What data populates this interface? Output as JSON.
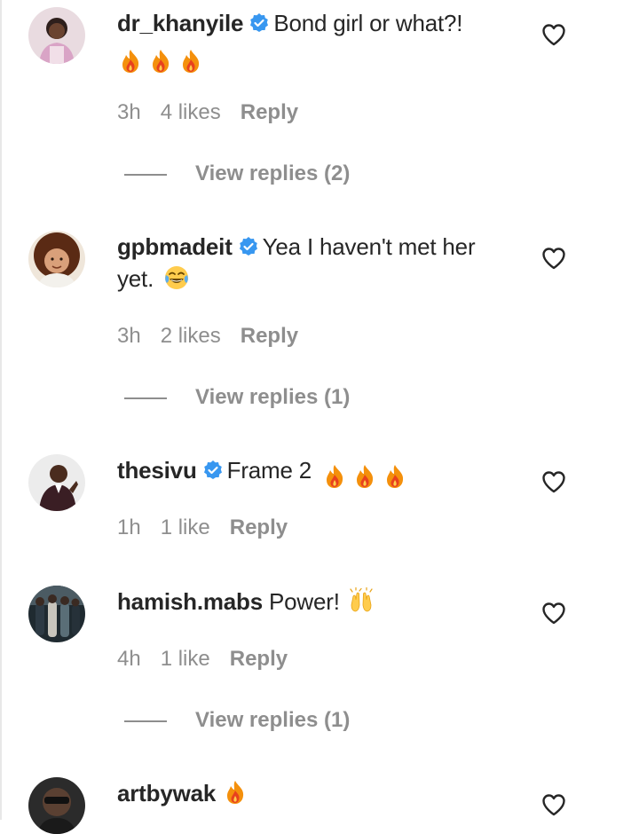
{
  "comments": [
    {
      "username": "dr_khanyile",
      "verified": true,
      "text": "Bond girl or what?!",
      "emojis": [
        "fire-emoji",
        "fire-emoji",
        "fire-emoji"
      ],
      "time": "3h",
      "likes": "4 likes",
      "reply_label": "Reply",
      "view_replies": "View replies (2)"
    },
    {
      "username": "gpbmadeit",
      "verified": true,
      "text_line1": "Yea I haven't met her",
      "text_line2": "yet.",
      "emojis": [
        "tears-of-joy-emoji"
      ],
      "time": "3h",
      "likes": "2 likes",
      "reply_label": "Reply",
      "view_replies": "View replies (1)"
    },
    {
      "username": "thesivu",
      "verified": true,
      "text": "Frame 2",
      "emojis": [
        "fire-emoji",
        "fire-emoji",
        "fire-emoji"
      ],
      "time": "1h",
      "likes": "1 like",
      "reply_label": "Reply"
    },
    {
      "username": "hamish.mabs",
      "verified": false,
      "text": "Power!",
      "emojis": [
        "raising-hands-emoji"
      ],
      "time": "4h",
      "likes": "1 like",
      "reply_label": "Reply",
      "view_replies": "View replies (1)"
    },
    {
      "username": "artbywak",
      "verified": false,
      "text": "",
      "emojis": [
        "fire-emoji"
      ]
    }
  ],
  "colors": {
    "text": "#262626",
    "secondary": "#8e8e8e",
    "verified_blue": "#3897f0",
    "fire_orange": "#f4900c",
    "fire_red": "#e8411e"
  }
}
